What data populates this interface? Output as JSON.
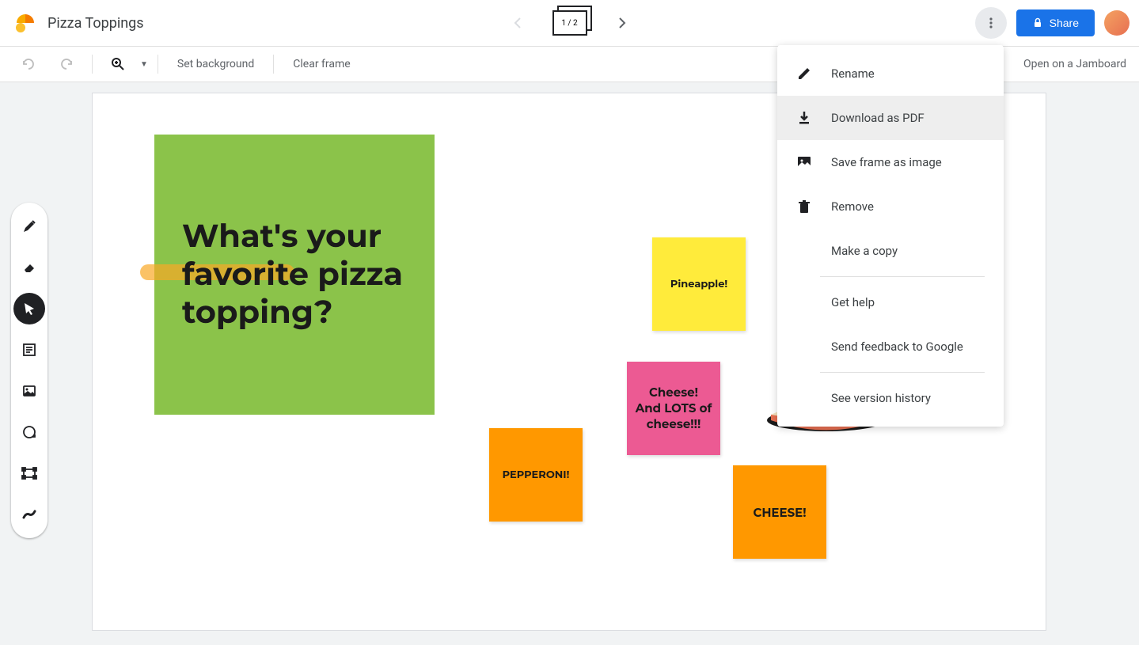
{
  "header": {
    "title": "Pizza Toppings",
    "frameCounter": "1 / 2",
    "shareLabel": "Share"
  },
  "toolbar": {
    "setBackground": "Set background",
    "clearFrame": "Clear frame",
    "openJamboard": "Open on a Jamboard"
  },
  "bigNote": {
    "text": "What's your favorite pizza topping?"
  },
  "stickies": {
    "pineapple": "Pineapple!",
    "pepperoni": "PEPPERONI!",
    "cheese": "Cheese! And LOTS of cheese!!!",
    "cheese2": "CHEESE!"
  },
  "menu": {
    "rename": "Rename",
    "downloadPdf": "Download as PDF",
    "saveImage": "Save frame as image",
    "remove": "Remove",
    "makeCopy": "Make a copy",
    "getHelp": "Get help",
    "sendFeedback": "Send feedback to Google",
    "versionHistory": "See version history"
  }
}
